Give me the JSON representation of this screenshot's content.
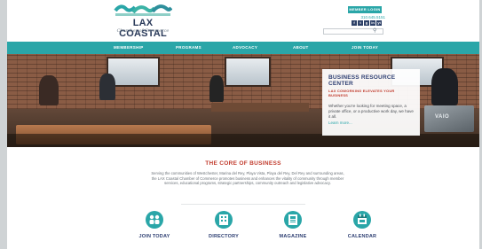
{
  "brand": {
    "name": "LAX COASTAL",
    "tagline": "Chamber of Commerce"
  },
  "header": {
    "member_login": "MEMBER LOGIN",
    "phone": "310.645.5151",
    "socials": [
      "f",
      "t",
      "g",
      "in",
      "yt"
    ],
    "search_placeholder": ""
  },
  "nav": {
    "items": [
      "MEMBERSHIP",
      "PROGRAMS",
      "ADVOCACY",
      "ABOUT",
      "JOIN TODAY"
    ]
  },
  "hero": {
    "card_title": "BUSINESS RESOURCE CENTER",
    "card_subtitle": "LAX COWORKING ELEVATES YOUR BUSINESS",
    "card_body": "Whether you're looking for meeting space, a private office, or a productive work day, we have it all.",
    "card_link": "Learn more...",
    "laptop_brand": "VAIO"
  },
  "core": {
    "title": "THE CORE OF BUSINESS",
    "text": "Serving the communities of Westchester, Marina del Rey, Playa Vista, Playa del Rey, Del Rey and surrounding areas, the LAX Coastal Chamber of Commerce promotes business and enhances the vitality of community through member services, educational programs, strategic partnerships, community outreach and legislative advocacy."
  },
  "features": [
    {
      "label": "JOIN TODAY",
      "icon": "people-icon"
    },
    {
      "label": "DIRECTORY",
      "icon": "building-icon"
    },
    {
      "label": "MAGAZINE",
      "icon": "magazine-icon"
    },
    {
      "label": "CALENDAR",
      "icon": "calendar-icon"
    }
  ],
  "colors": {
    "teal": "#2aa6a8",
    "navy": "#2e3f72",
    "red": "#c0392b"
  }
}
